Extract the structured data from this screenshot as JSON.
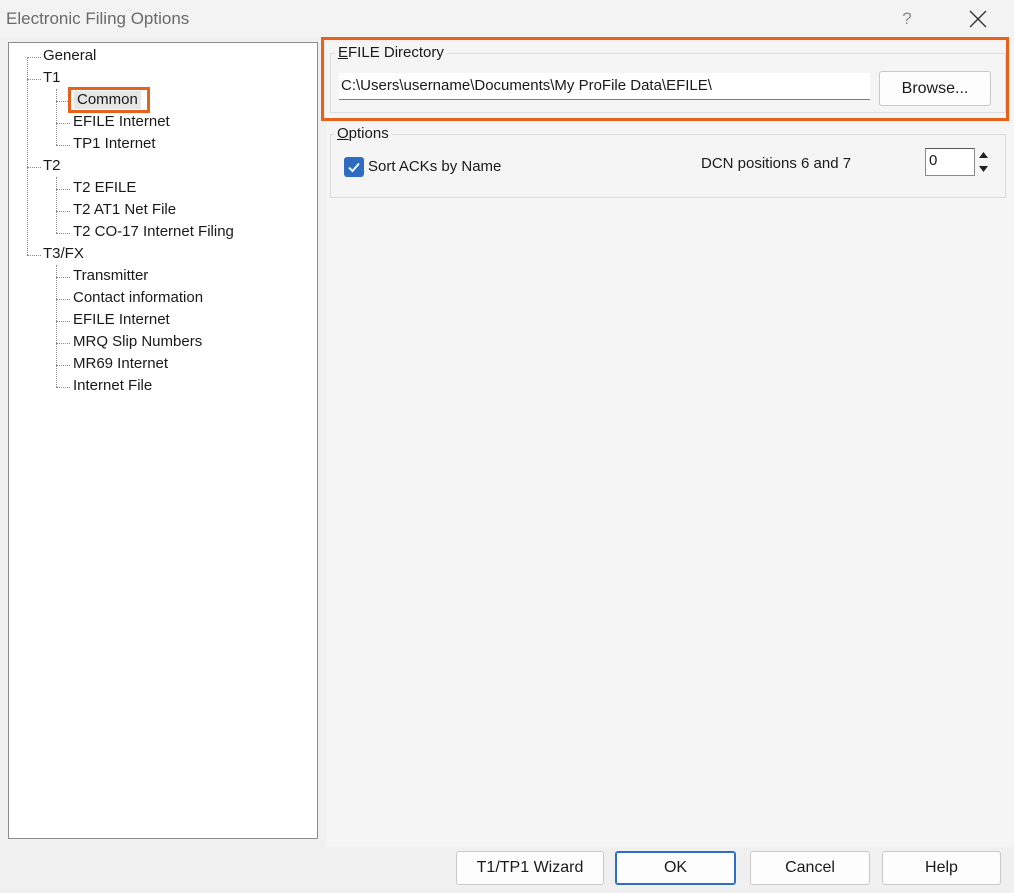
{
  "window": {
    "title": "Electronic Filing Options",
    "help_label": "?"
  },
  "tree": {
    "general": "General",
    "t1": {
      "label": "T1",
      "children": [
        "Common",
        "EFILE Internet",
        "TP1 Internet"
      ]
    },
    "t2": {
      "label": "T2",
      "children": [
        "T2 EFILE",
        "T2 AT1 Net File",
        "T2 CO-17 Internet Filing"
      ]
    },
    "t3fx": {
      "label": "T3/FX",
      "children": [
        "Transmitter",
        "Contact information",
        "EFILE Internet",
        "MRQ Slip Numbers",
        "MR69 Internet",
        "Internet File"
      ]
    },
    "selected": "Common"
  },
  "efile_directory": {
    "legend_mnemonic": "E",
    "legend_rest": "FILE Directory",
    "path": "C:\\Users\\username\\Documents\\My ProFile Data\\EFILE\\",
    "browse_label": "Browse..."
  },
  "options": {
    "legend_mnemonic": "O",
    "legend_rest": "ptions",
    "sort_acks_label": "Sort ACKs by Name",
    "sort_acks_checked": true,
    "dcn_label": "DCN positions 6 and 7",
    "dcn_value": "0"
  },
  "buttons": {
    "wizard": "T1/TP1 Wizard",
    "ok": "OK",
    "cancel": "Cancel",
    "help": "Help"
  },
  "colors": {
    "highlight": "#e8611a",
    "checkbox": "#2f6cc1",
    "default_button_border": "#2b6fc9"
  }
}
